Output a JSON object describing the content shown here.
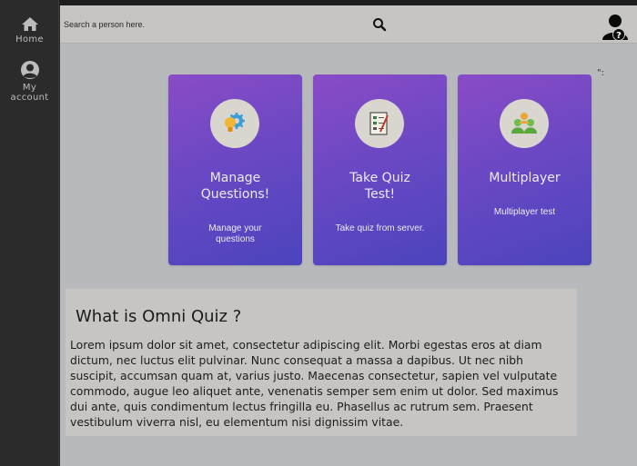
{
  "sidebar": {
    "items": [
      {
        "label": "Home",
        "icon": "home-icon"
      },
      {
        "label": "My\naccount",
        "icon": "user-icon"
      }
    ]
  },
  "topbar": {
    "search_placeholder": "Search a person here.",
    "search_icon": "search-icon",
    "avatar_icon": "user-help-avatar-icon"
  },
  "quote_mark": "\":",
  "cards": [
    {
      "title": "Manage Questions!",
      "description": "Manage your questions",
      "icon": "gear-bulb-icon"
    },
    {
      "title": "Take Quiz Test!",
      "description": "Take quiz from server.",
      "icon": "quiz-sheet-icon"
    },
    {
      "title": "Multiplayer",
      "description": "Multiplayer test",
      "icon": "group-users-icon"
    }
  ],
  "about": {
    "title": "What is Omni Quiz ?",
    "text": "Lorem ipsum dolor sit amet, consectetur adipiscing elit. Morbi egestas eros at diam dictum, nec luctus elit pulvinar. Nunc consequat a massa a dapibus. Ut nec nibh suscipit, accumsan quam at, varius justo. Maecenas consectetur, sapien vel vulputate commodo, augue leo aliquet ante, venenatis semper sem enim ut dolor. Sed maximus dui ante, quis condimentum lectus fringilla eu. Phasellus ac rutrum sem. Praesent vestibulum viverra nisl, eu elementum nisi dignissim vitae."
  },
  "colors": {
    "sidebar": "#2b2b2b",
    "main_bg": "#b8b9bd",
    "card_gradient_start": "#8a4bc6",
    "card_gradient_end": "#4b44bd"
  }
}
